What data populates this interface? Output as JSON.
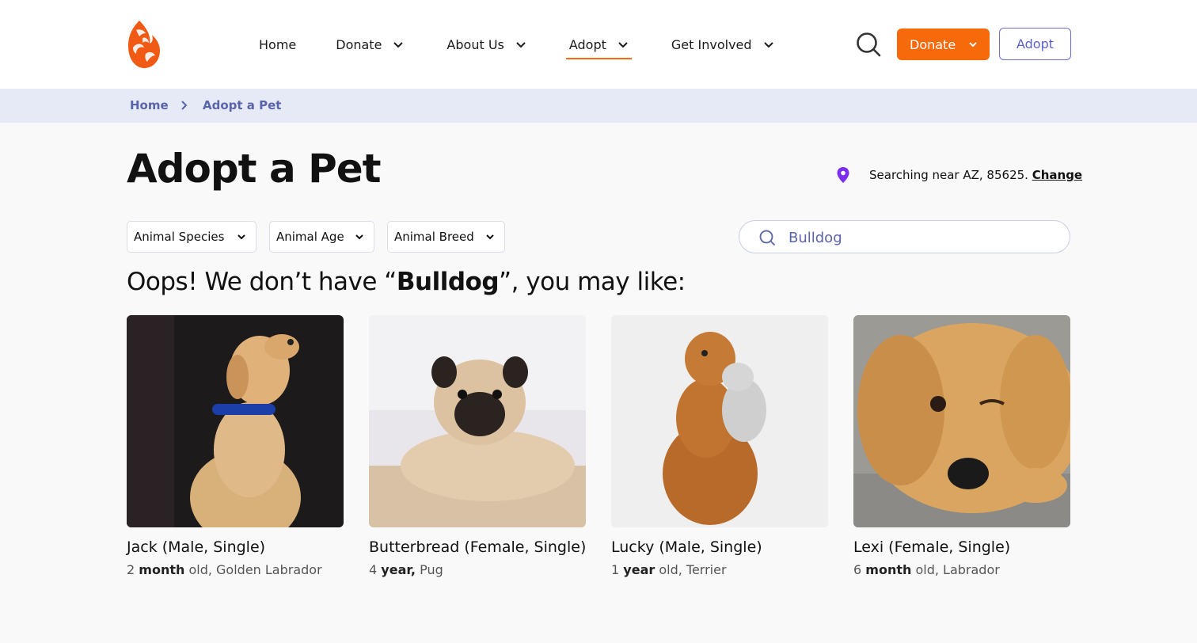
{
  "nav": {
    "items": [
      {
        "label": "Home",
        "has_dropdown": false,
        "active": false
      },
      {
        "label": "Donate",
        "has_dropdown": true,
        "active": false
      },
      {
        "label": "About Us",
        "has_dropdown": true,
        "active": false
      },
      {
        "label": "Adopt",
        "has_dropdown": true,
        "active": true
      },
      {
        "label": "Get Involved",
        "has_dropdown": true,
        "active": false
      }
    ],
    "donate_button": "Donate",
    "adopt_button": "Adopt",
    "accent_color": "#f76a0b",
    "adopt_button_color": "#5b60c8"
  },
  "breadcrumb": {
    "home": "Home",
    "current": "Adopt a Pet"
  },
  "page": {
    "title": "Adopt a Pet",
    "location_label": "Searching near AZ, 85625.",
    "location_change": "Change"
  },
  "filters": [
    {
      "label": "Animal Species"
    },
    {
      "label": "Animal Age"
    },
    {
      "label": "Animal Breed"
    }
  ],
  "search": {
    "value": "Bulldog"
  },
  "message": {
    "prefix": "Oops! We don’t have “",
    "term": "Bulldog",
    "suffix": "”, you may like:"
  },
  "pets": [
    {
      "name": "Jack (Male, Single)",
      "age_num": "2",
      "age_unit": "month",
      "age_rest": " old, Golden Labrador"
    },
    {
      "name": "Butterbread (Female, Single)",
      "age_num": "4",
      "age_unit": "year,",
      "age_rest": " Pug"
    },
    {
      "name": "Lucky (Male, Single)",
      "age_num": "1",
      "age_unit": "year",
      "age_rest": " old, Terrier"
    },
    {
      "name": "Lexi (Female, Single)",
      "age_num": "6",
      "age_unit": "month",
      "age_rest": " old, Labrador"
    }
  ]
}
